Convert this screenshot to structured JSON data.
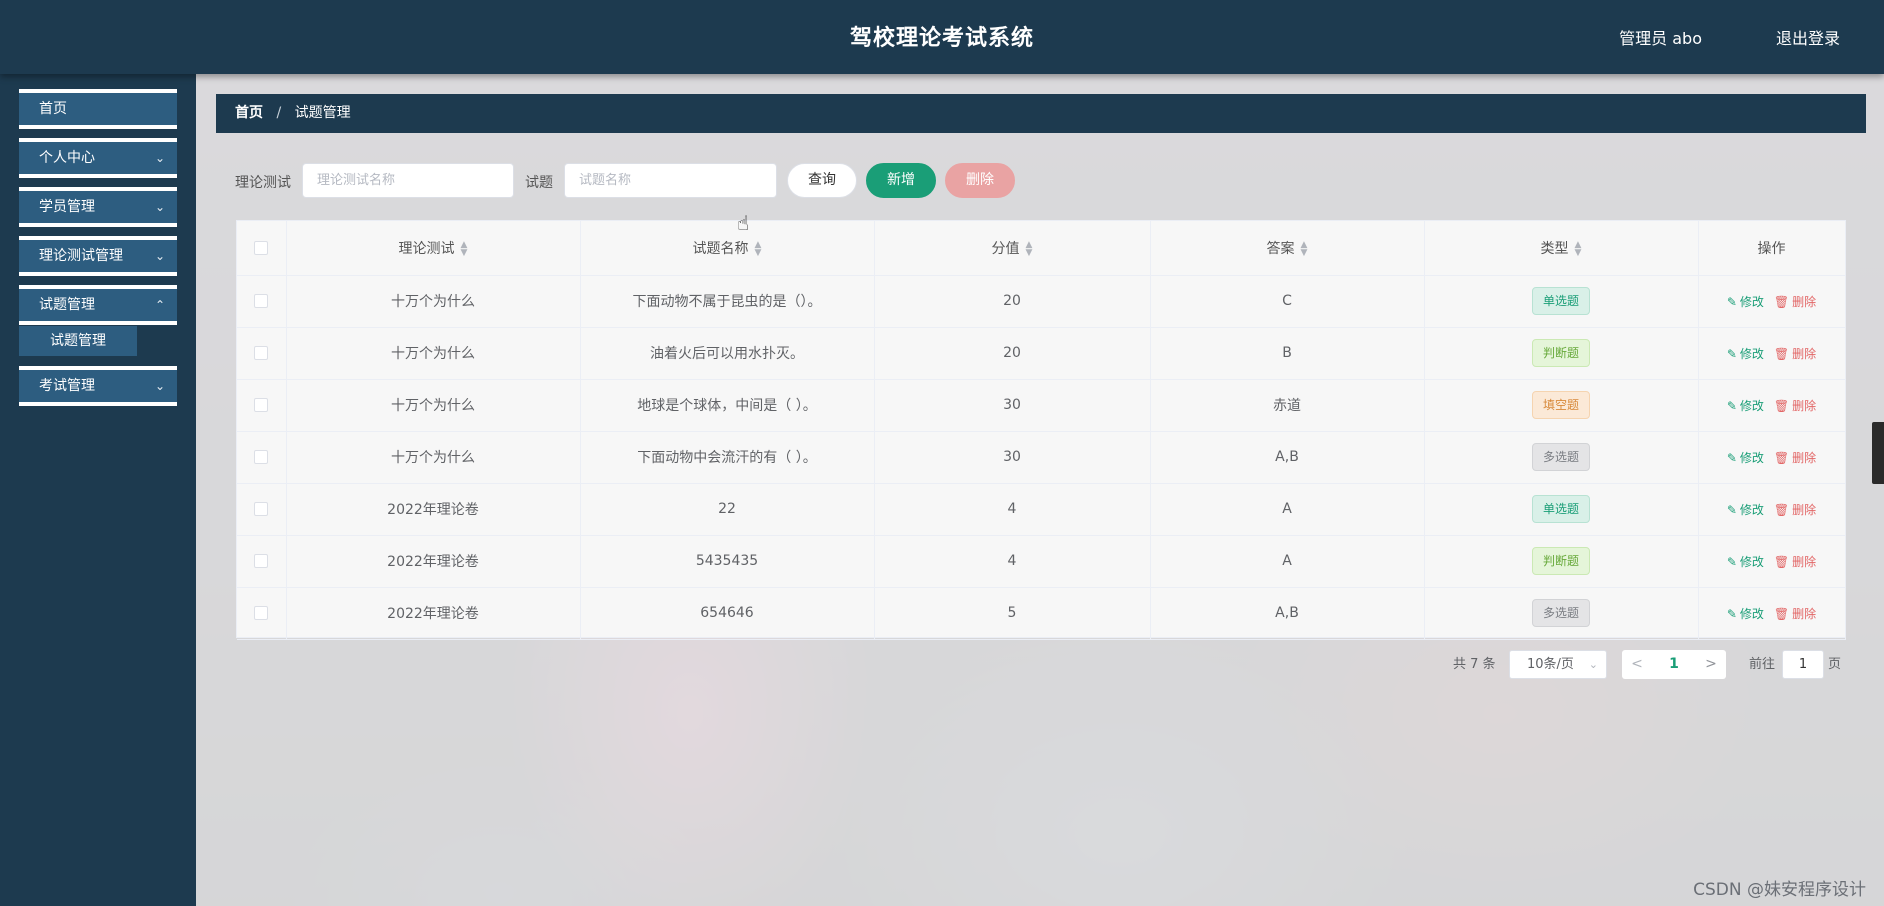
{
  "header": {
    "title": "驾校理论考试系统",
    "user": "管理员 abo",
    "logout": "退出登录"
  },
  "sidebar": {
    "items": [
      {
        "label": "首页",
        "expandable": false
      },
      {
        "label": "个人中心",
        "expandable": true
      },
      {
        "label": "学员管理",
        "expandable": true
      },
      {
        "label": "理论测试管理",
        "expandable": true
      },
      {
        "label": "试题管理",
        "expandable": true
      },
      {
        "label": "考试管理",
        "expandable": true
      }
    ],
    "sub_items": {
      "question_mgmt": "试题管理"
    }
  },
  "breadcrumb": {
    "home": "首页",
    "separator": "/",
    "current": "试题管理"
  },
  "search": {
    "test_label": "理论测试",
    "test_placeholder": "理论测试名称",
    "question_label": "试题",
    "question_placeholder": "试题名称",
    "query_button": "查询",
    "add_button": "新增",
    "delete_button": "删除"
  },
  "table": {
    "columns": [
      "理论测试",
      "试题名称",
      "分值",
      "答案",
      "类型",
      "操作"
    ],
    "edit_label": "修改",
    "delete_label": "删除",
    "rows": [
      {
        "test": "十万个为什么",
        "question": "下面动物不属于昆虫的是（）。",
        "score": "20",
        "answer": "C",
        "type": "单选题",
        "type_key": "single"
      },
      {
        "test": "十万个为什么",
        "question": "油着火后可以用水扑灭。",
        "score": "20",
        "answer": "B",
        "type": "判断题",
        "type_key": "judge"
      },
      {
        "test": "十万个为什么",
        "question": "地球是个球体，中间是（ ）。",
        "score": "30",
        "answer": "赤道",
        "type": "填空题",
        "type_key": "fill"
      },
      {
        "test": "十万个为什么",
        "question": "下面动物中会流汗的有（ ）。",
        "score": "30",
        "answer": "A,B",
        "type": "多选题",
        "type_key": "multi"
      },
      {
        "test": "2022年理论卷",
        "question": "22",
        "score": "4",
        "answer": "A",
        "type": "单选题",
        "type_key": "single"
      },
      {
        "test": "2022年理论卷",
        "question": "5435435",
        "score": "4",
        "answer": "A",
        "type": "判断题",
        "type_key": "judge"
      },
      {
        "test": "2022年理论卷",
        "question": "654646",
        "score": "5",
        "answer": "A,B",
        "type": "多选题",
        "type_key": "multi"
      }
    ]
  },
  "pagination": {
    "total": "共 7 条",
    "page_size": "10条/页",
    "current_page": "1",
    "goto_label": "前往",
    "goto_value": "1",
    "page_suffix": "页"
  },
  "watermark": "CSDN @妹安程序设计",
  "colors": {
    "header_bg": "#1d3a4f",
    "menu_bg": "#2d5d80",
    "accent": "#1a9e77",
    "danger": "#e26565"
  }
}
